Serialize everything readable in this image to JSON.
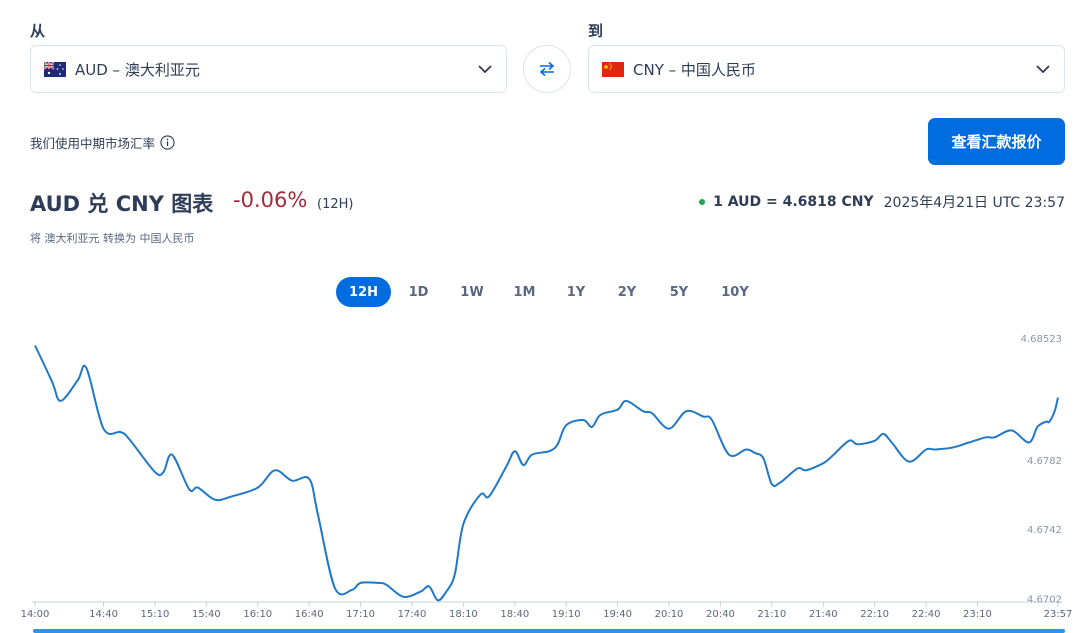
{
  "from": {
    "label": "从",
    "currency": "AUD – 澳大利亚元",
    "flag": "flag-australia-icon"
  },
  "to": {
    "label": "到",
    "currency": "CNY – 中国人民币",
    "flag": "flag-china-icon"
  },
  "note": "我们使用中期市场汇率",
  "quote_button": "查看汇款报价",
  "heading": {
    "title": "AUD 兑 CNY 图表",
    "change": "-0.06%",
    "period": "(12H)",
    "subtitle": "将 澳大利亚元 转换为 中国人民币"
  },
  "rate": {
    "value": "1 AUD = 4.6818 CNY",
    "timestamp": "2025年4月21日 UTC 23:57"
  },
  "timeframes": [
    "12H",
    "1D",
    "1W",
    "1M",
    "1Y",
    "2Y",
    "5Y",
    "10Y"
  ],
  "active_timeframe": "12H",
  "colors": {
    "accent": "#006ce0",
    "line": "#1f78c8",
    "negative": "#a22b3a",
    "live_dot": "#1fa54a"
  },
  "chart_data": {
    "type": "line",
    "x_ticks": [
      "14:00",
      "14:40",
      "15:10",
      "15:40",
      "16:10",
      "16:40",
      "17:10",
      "17:40",
      "18:10",
      "18:40",
      "19:10",
      "19:40",
      "20:10",
      "20:40",
      "21:10",
      "21:40",
      "22:10",
      "22:40",
      "23:10",
      "23:57"
    ],
    "y_ticks": [
      "4.68523",
      "4.6782",
      "4.6742",
      "4.6702"
    ],
    "ylim": [
      4.67,
      4.68523
    ],
    "x": [
      "14:00",
      "14:10",
      "14:15",
      "14:25",
      "14:30",
      "14:40",
      "14:50",
      "14:55",
      "15:10",
      "15:15",
      "15:20",
      "15:30",
      "15:35",
      "15:45",
      "15:55",
      "16:10",
      "16:20",
      "16:30",
      "16:40",
      "16:45",
      "16:55",
      "17:05",
      "17:10",
      "17:20",
      "17:25",
      "17:35",
      "17:45",
      "17:50",
      "17:55",
      "18:00",
      "18:05",
      "18:10",
      "18:20",
      "18:25",
      "18:35",
      "18:40",
      "18:45",
      "18:50",
      "19:00",
      "19:05",
      "19:10",
      "19:20",
      "19:25",
      "19:30",
      "19:40",
      "19:45",
      "19:55",
      "20:00",
      "20:10",
      "20:20",
      "20:30",
      "20:35",
      "20:45",
      "20:55",
      "21:00",
      "21:05",
      "21:10",
      "21:15",
      "21:25",
      "21:30",
      "21:40",
      "21:45",
      "21:55",
      "22:00",
      "22:10",
      "22:15",
      "22:20",
      "22:30",
      "22:40",
      "22:45",
      "22:55",
      "23:05",
      "23:15",
      "23:20",
      "23:30",
      "23:40",
      "23:45",
      "23:50",
      "23:52",
      "23:55",
      "23:57"
    ],
    "y": [
      4.6848,
      4.6827,
      4.6816,
      4.6828,
      4.6835,
      4.68,
      4.6798,
      4.6794,
      4.6775,
      4.6775,
      4.6785,
      4.6765,
      4.6766,
      4.6759,
      4.6761,
      4.6766,
      4.6776,
      4.677,
      4.6771,
      4.6751,
      4.6708,
      4.6707,
      4.6711,
      4.6711,
      4.671,
      4.6703,
      4.6706,
      4.6709,
      4.6701,
      4.6706,
      4.6716,
      4.6745,
      4.6762,
      4.6761,
      4.6778,
      4.6787,
      4.6779,
      4.6785,
      4.6787,
      4.6791,
      4.6802,
      4.6805,
      4.6801,
      4.6808,
      4.6811,
      4.6816,
      4.681,
      4.6809,
      4.68,
      4.681,
      4.6807,
      4.6805,
      4.6785,
      4.6788,
      4.6786,
      4.6783,
      4.6768,
      4.6769,
      4.6777,
      4.6776,
      4.678,
      4.6784,
      4.6793,
      4.6791,
      4.6793,
      4.6797,
      4.6792,
      4.6781,
      4.6788,
      4.6788,
      4.6789,
      4.6792,
      4.6795,
      4.6795,
      4.6799,
      4.6792,
      4.6801,
      4.6804,
      4.6804,
      4.681,
      4.6818
    ]
  }
}
